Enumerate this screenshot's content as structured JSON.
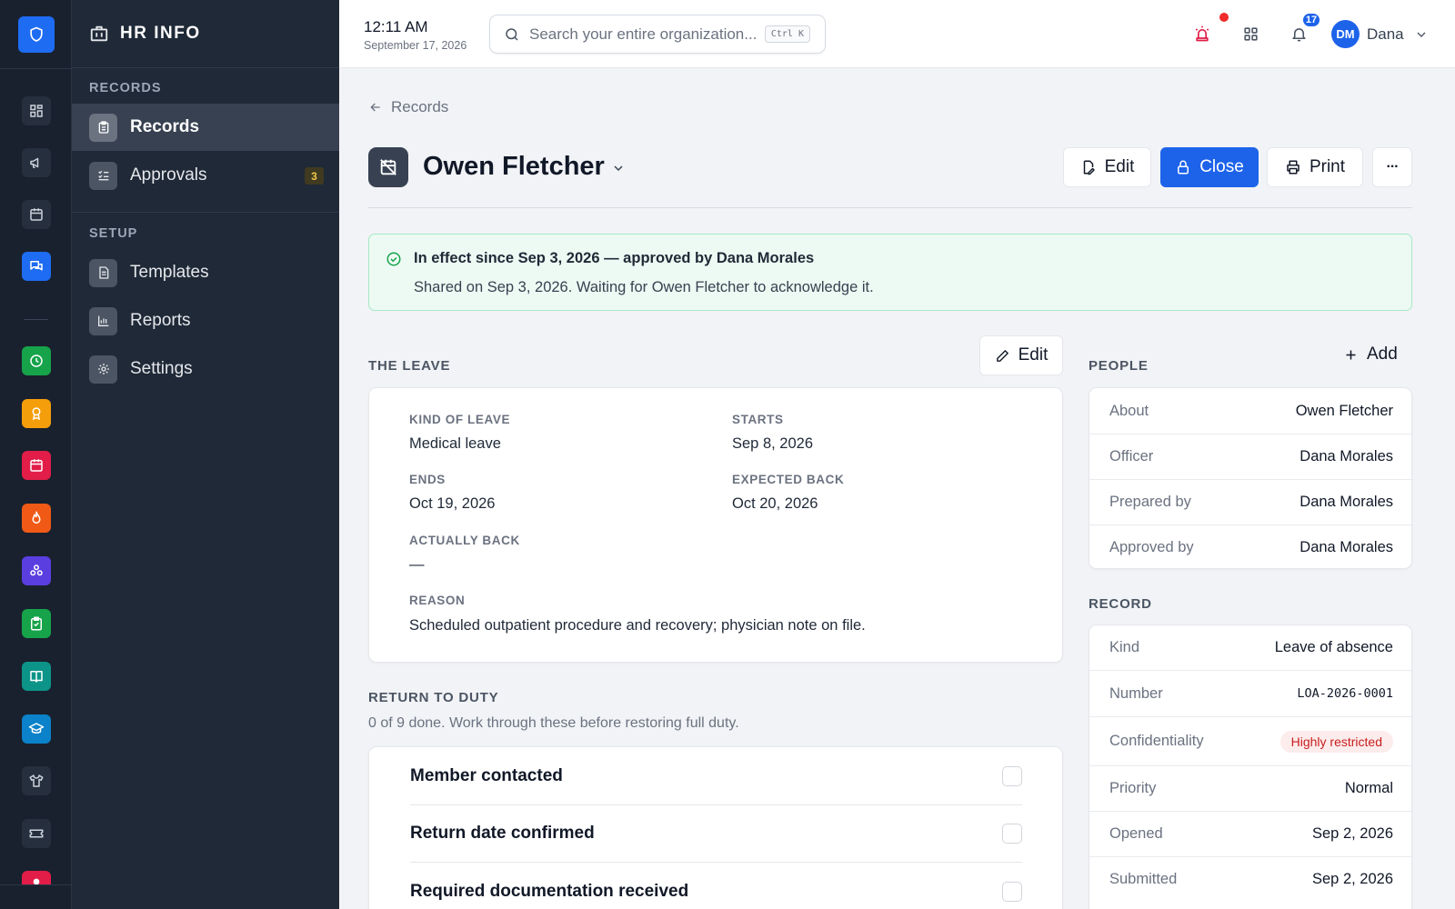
{
  "app": {
    "title": "HR INFO"
  },
  "sidebar": {
    "section_records": "RECORDS",
    "section_setup": "SETUP",
    "items": [
      {
        "label": "Records",
        "icon": "clipboard-icon",
        "active": true
      },
      {
        "label": "Approvals",
        "icon": "checklist-icon",
        "count": "3"
      },
      {
        "label": "Templates",
        "icon": "document-icon"
      },
      {
        "label": "Reports",
        "icon": "bar-chart-icon"
      },
      {
        "label": "Settings",
        "icon": "gear-icon"
      }
    ]
  },
  "rail": {
    "icons": [
      "shield-icon",
      "dashboard-icon",
      "megaphone-icon",
      "calendar-icon",
      "chat-icon",
      "clock-icon",
      "award-icon",
      "calendar-red-icon",
      "flame-icon",
      "team-icon",
      "clipboard-check-icon",
      "book-icon",
      "graduation-cap-icon",
      "shirt-icon",
      "ticket-icon",
      "alert-icon"
    ]
  },
  "topbar": {
    "time": "12:11 AM",
    "date": "September 17, 2026",
    "search_placeholder": "Search your entire organization...",
    "search_shortcut": "Ctrl K",
    "notifications_count": "17",
    "user_initials": "DM",
    "user_name": "Dana"
  },
  "colors": {
    "accent": "#1d63ea",
    "success": "#16a34a",
    "danger": "#c81e1e"
  },
  "breadcrumb": {
    "label": "Records"
  },
  "header": {
    "title": "Owen Fletcher",
    "edit_label": "Edit",
    "close_label": "Close",
    "print_label": "Print",
    "more_label": "···"
  },
  "banner": {
    "title": "In effect since Sep 3, 2026 — approved by Dana Morales",
    "text": "Shared on Sep 3, 2026. Waiting for Owen Fletcher to acknowledge it."
  },
  "leave": {
    "section_title": "THE LEAVE",
    "edit_label": "Edit",
    "fields": {
      "kind": {
        "label": "KIND OF LEAVE",
        "value": "Medical leave"
      },
      "starts": {
        "label": "STARTS",
        "value": "Sep 8, 2026"
      },
      "ends": {
        "label": "ENDS",
        "value": "Oct 19, 2026"
      },
      "expected_back": {
        "label": "EXPECTED BACK",
        "value": "Oct 20, 2026"
      },
      "actually_back": {
        "label": "ACTUALLY BACK",
        "value": "—"
      },
      "reason": {
        "label": "REASON",
        "value": "Scheduled outpatient procedure and recovery; physician note on file."
      }
    }
  },
  "return_to_duty": {
    "title": "RETURN TO DUTY",
    "subtitle": "0 of 9 done. Work through these before restoring full duty.",
    "items": [
      {
        "label": "Member contacted",
        "checked": false
      },
      {
        "label": "Return date confirmed",
        "checked": false
      },
      {
        "label": "Required documentation received",
        "checked": false
      }
    ]
  },
  "people": {
    "title": "PEOPLE",
    "add_label": "Add",
    "rows": [
      {
        "key": "About",
        "value": "Owen Fletcher"
      },
      {
        "key": "Officer",
        "value": "Dana Morales"
      },
      {
        "key": "Prepared by",
        "value": "Dana Morales"
      },
      {
        "key": "Approved by",
        "value": "Dana Morales"
      }
    ]
  },
  "record": {
    "title": "RECORD",
    "rows": [
      {
        "key": "Kind",
        "value": "Leave of absence"
      },
      {
        "key": "Number",
        "value": "LOA-2026-0001"
      },
      {
        "key": "Confidentiality",
        "value": "Highly restricted"
      },
      {
        "key": "Priority",
        "value": "Normal"
      },
      {
        "key": "Opened",
        "value": "Sep 2, 2026"
      },
      {
        "key": "Submitted",
        "value": "Sep 2, 2026"
      }
    ]
  }
}
